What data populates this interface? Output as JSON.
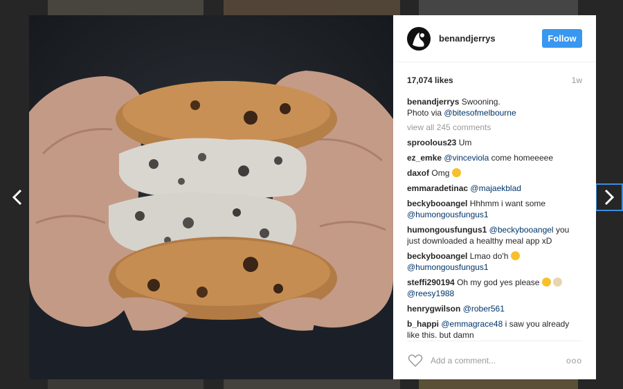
{
  "post": {
    "username": "benandjerrys",
    "follow_label": "Follow",
    "likes": "17,074 likes",
    "age": "1w",
    "caption_user": "benandjerrys",
    "caption_text": "Swooning.",
    "caption_line2": "Photo via",
    "caption_mention": "@bitesofmelbourne",
    "view_all": "view all 245 comments",
    "add_comment_placeholder": "Add a comment...",
    "more_label": "ooo"
  },
  "comments": [
    {
      "user": "sproolous23",
      "text": "Um"
    },
    {
      "user": "ez_emke",
      "mention": "@vinceviola",
      "text": "come homeeeee"
    },
    {
      "user": "daxof",
      "text": "Omg",
      "emoji": "heart-eyes-emoji"
    },
    {
      "user": "emmaradetinac",
      "mention": "@majaekblad"
    },
    {
      "user": "beckybooangel",
      "text": "Hhhmm i want some",
      "mention2": "@humongousfungus1"
    },
    {
      "user": "humongousfungus1",
      "mention": "@beckybooangel",
      "text": "you just downloaded a healthy meal app xD"
    },
    {
      "user": "beckybooangel",
      "text": "Lmao do'h",
      "emoji": "crying-laughing-emoji",
      "mention2": "@humongousfungus1"
    },
    {
      "user": "steffi290194",
      "text": "Oh my god yes please",
      "emoji": "heart-eyes-ice-cream-emoji",
      "mention2": "@reesy1988"
    },
    {
      "user": "henrygwilson",
      "mention": "@rober561"
    },
    {
      "user": "b_happi",
      "mention": "@emmagrace48",
      "text": "i saw you already like this. but damn"
    }
  ],
  "colors": {
    "accent": "#3897f0",
    "mention": "#003569",
    "nav_focus": "#3a8de0"
  }
}
